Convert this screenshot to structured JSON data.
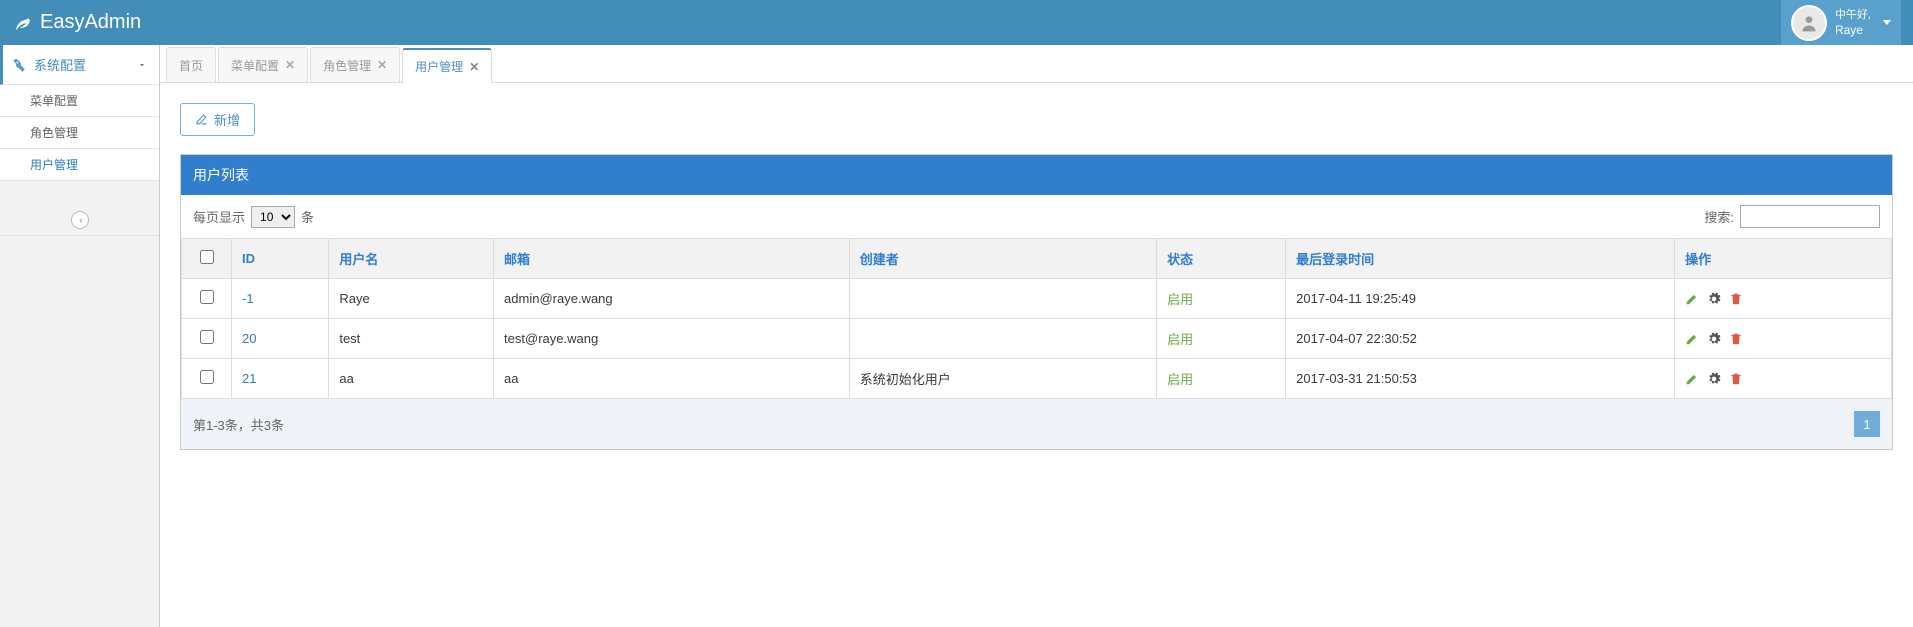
{
  "navbar": {
    "title": "EasyAdmin",
    "greeting": "中午好,",
    "username": "Raye"
  },
  "sidebar": {
    "parent": "系统配置",
    "items": [
      "菜单配置",
      "角色管理",
      "用户管理"
    ]
  },
  "tabs": [
    {
      "label": "首页",
      "closable": false,
      "active": false
    },
    {
      "label": "菜单配置",
      "closable": true,
      "active": false
    },
    {
      "label": "角色管理",
      "closable": true,
      "active": false
    },
    {
      "label": "用户管理",
      "closable": true,
      "active": true
    }
  ],
  "toolbar": {
    "add_label": "新增"
  },
  "panel": {
    "title": "用户列表",
    "per_page_prefix": "每页显示",
    "per_page_value": "10",
    "per_page_suffix": "条",
    "search_label": "搜索:",
    "search_value": ""
  },
  "table": {
    "headers": [
      "",
      "ID",
      "用户名",
      "邮箱",
      "创建者",
      "状态",
      "最后登录时间",
      "操作"
    ],
    "rows": [
      {
        "id": "-1",
        "username": "Raye",
        "email": "admin@raye.wang",
        "creator": "",
        "status": "启用",
        "last_login": "2017-04-11 19:25:49"
      },
      {
        "id": "20",
        "username": "test",
        "email": "test@raye.wang",
        "creator": "",
        "status": "启用",
        "last_login": "2017-04-07 22:30:52"
      },
      {
        "id": "21",
        "username": "aa",
        "email": "aa",
        "creator": "系统初始化用户",
        "status": "启用",
        "last_login": "2017-03-31 21:50:53"
      }
    ]
  },
  "footer": {
    "info": "第1-3条，共3条",
    "current_page": "1"
  }
}
